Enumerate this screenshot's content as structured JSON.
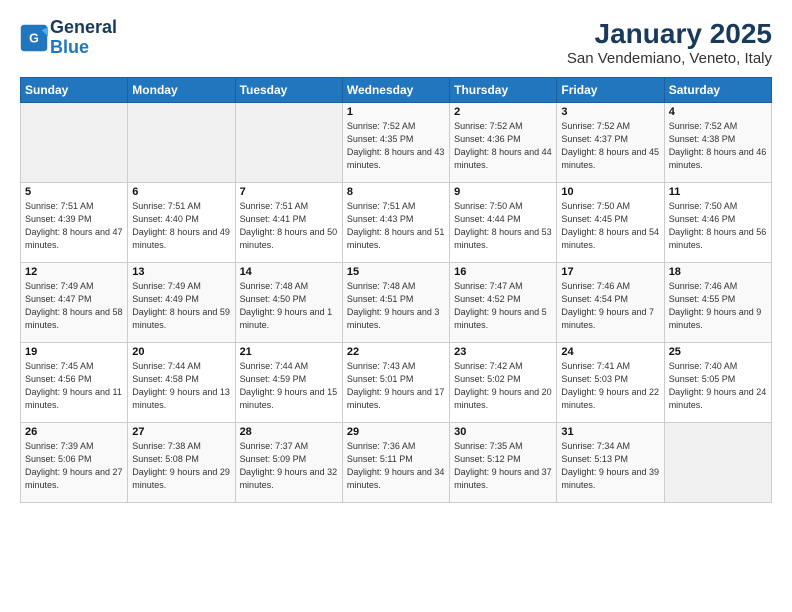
{
  "logo": {
    "line1": "General",
    "line2": "Blue"
  },
  "title": "January 2025",
  "subtitle": "San Vendemiano, Veneto, Italy",
  "weekdays": [
    "Sunday",
    "Monday",
    "Tuesday",
    "Wednesday",
    "Thursday",
    "Friday",
    "Saturday"
  ],
  "weeks": [
    [
      {
        "day": "",
        "info": ""
      },
      {
        "day": "",
        "info": ""
      },
      {
        "day": "",
        "info": ""
      },
      {
        "day": "1",
        "info": "Sunrise: 7:52 AM\nSunset: 4:35 PM\nDaylight: 8 hours and 43 minutes."
      },
      {
        "day": "2",
        "info": "Sunrise: 7:52 AM\nSunset: 4:36 PM\nDaylight: 8 hours and 44 minutes."
      },
      {
        "day": "3",
        "info": "Sunrise: 7:52 AM\nSunset: 4:37 PM\nDaylight: 8 hours and 45 minutes."
      },
      {
        "day": "4",
        "info": "Sunrise: 7:52 AM\nSunset: 4:38 PM\nDaylight: 8 hours and 46 minutes."
      }
    ],
    [
      {
        "day": "5",
        "info": "Sunrise: 7:51 AM\nSunset: 4:39 PM\nDaylight: 8 hours and 47 minutes."
      },
      {
        "day": "6",
        "info": "Sunrise: 7:51 AM\nSunset: 4:40 PM\nDaylight: 8 hours and 49 minutes."
      },
      {
        "day": "7",
        "info": "Sunrise: 7:51 AM\nSunset: 4:41 PM\nDaylight: 8 hours and 50 minutes."
      },
      {
        "day": "8",
        "info": "Sunrise: 7:51 AM\nSunset: 4:43 PM\nDaylight: 8 hours and 51 minutes."
      },
      {
        "day": "9",
        "info": "Sunrise: 7:50 AM\nSunset: 4:44 PM\nDaylight: 8 hours and 53 minutes."
      },
      {
        "day": "10",
        "info": "Sunrise: 7:50 AM\nSunset: 4:45 PM\nDaylight: 8 hours and 54 minutes."
      },
      {
        "day": "11",
        "info": "Sunrise: 7:50 AM\nSunset: 4:46 PM\nDaylight: 8 hours and 56 minutes."
      }
    ],
    [
      {
        "day": "12",
        "info": "Sunrise: 7:49 AM\nSunset: 4:47 PM\nDaylight: 8 hours and 58 minutes."
      },
      {
        "day": "13",
        "info": "Sunrise: 7:49 AM\nSunset: 4:49 PM\nDaylight: 8 hours and 59 minutes."
      },
      {
        "day": "14",
        "info": "Sunrise: 7:48 AM\nSunset: 4:50 PM\nDaylight: 9 hours and 1 minute."
      },
      {
        "day": "15",
        "info": "Sunrise: 7:48 AM\nSunset: 4:51 PM\nDaylight: 9 hours and 3 minutes."
      },
      {
        "day": "16",
        "info": "Sunrise: 7:47 AM\nSunset: 4:52 PM\nDaylight: 9 hours and 5 minutes."
      },
      {
        "day": "17",
        "info": "Sunrise: 7:46 AM\nSunset: 4:54 PM\nDaylight: 9 hours and 7 minutes."
      },
      {
        "day": "18",
        "info": "Sunrise: 7:46 AM\nSunset: 4:55 PM\nDaylight: 9 hours and 9 minutes."
      }
    ],
    [
      {
        "day": "19",
        "info": "Sunrise: 7:45 AM\nSunset: 4:56 PM\nDaylight: 9 hours and 11 minutes."
      },
      {
        "day": "20",
        "info": "Sunrise: 7:44 AM\nSunset: 4:58 PM\nDaylight: 9 hours and 13 minutes."
      },
      {
        "day": "21",
        "info": "Sunrise: 7:44 AM\nSunset: 4:59 PM\nDaylight: 9 hours and 15 minutes."
      },
      {
        "day": "22",
        "info": "Sunrise: 7:43 AM\nSunset: 5:01 PM\nDaylight: 9 hours and 17 minutes."
      },
      {
        "day": "23",
        "info": "Sunrise: 7:42 AM\nSunset: 5:02 PM\nDaylight: 9 hours and 20 minutes."
      },
      {
        "day": "24",
        "info": "Sunrise: 7:41 AM\nSunset: 5:03 PM\nDaylight: 9 hours and 22 minutes."
      },
      {
        "day": "25",
        "info": "Sunrise: 7:40 AM\nSunset: 5:05 PM\nDaylight: 9 hours and 24 minutes."
      }
    ],
    [
      {
        "day": "26",
        "info": "Sunrise: 7:39 AM\nSunset: 5:06 PM\nDaylight: 9 hours and 27 minutes."
      },
      {
        "day": "27",
        "info": "Sunrise: 7:38 AM\nSunset: 5:08 PM\nDaylight: 9 hours and 29 minutes."
      },
      {
        "day": "28",
        "info": "Sunrise: 7:37 AM\nSunset: 5:09 PM\nDaylight: 9 hours and 32 minutes."
      },
      {
        "day": "29",
        "info": "Sunrise: 7:36 AM\nSunset: 5:11 PM\nDaylight: 9 hours and 34 minutes."
      },
      {
        "day": "30",
        "info": "Sunrise: 7:35 AM\nSunset: 5:12 PM\nDaylight: 9 hours and 37 minutes."
      },
      {
        "day": "31",
        "info": "Sunrise: 7:34 AM\nSunset: 5:13 PM\nDaylight: 9 hours and 39 minutes."
      },
      {
        "day": "",
        "info": ""
      }
    ]
  ]
}
